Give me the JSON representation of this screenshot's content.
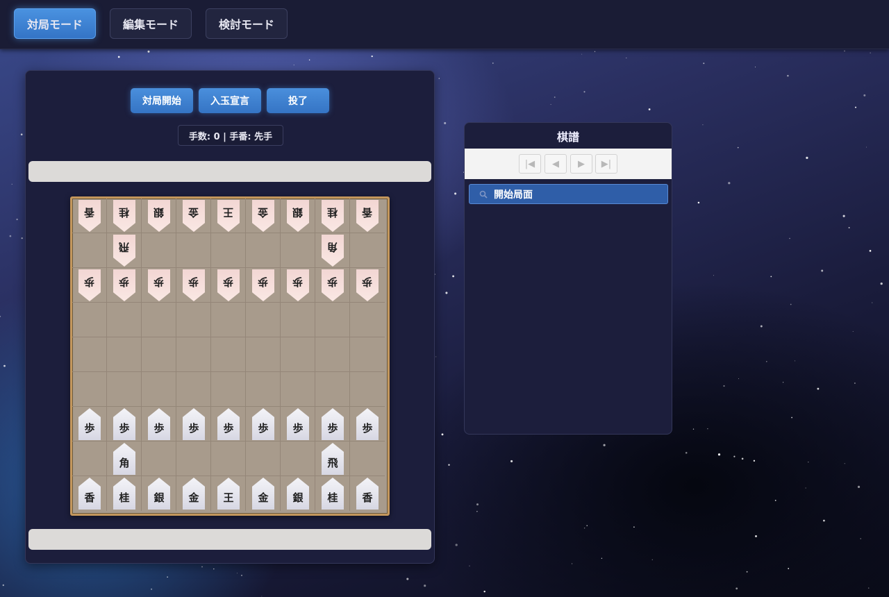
{
  "modes": {
    "tabs": [
      {
        "label": "対局モード",
        "active": true
      },
      {
        "label": "編集モード",
        "active": false
      },
      {
        "label": "検討モード",
        "active": false
      }
    ]
  },
  "controls": {
    "start_label": "対局開始",
    "declare_label": "入玉宣言",
    "resign_label": "投了"
  },
  "status": {
    "text": "手数: 0 | 手番: 先手"
  },
  "board": {
    "rows": [
      [
        "香",
        "桂",
        "銀",
        "金",
        "王",
        "金",
        "銀",
        "桂",
        "香"
      ],
      [
        "",
        "飛",
        "",
        "",
        "",
        "",
        "",
        "角",
        ""
      ],
      [
        "歩",
        "歩",
        "歩",
        "歩",
        "歩",
        "歩",
        "歩",
        "歩",
        "歩"
      ],
      [
        "",
        "",
        "",
        "",
        "",
        "",
        "",
        "",
        ""
      ],
      [
        "",
        "",
        "",
        "",
        "",
        "",
        "",
        "",
        ""
      ],
      [
        "",
        "",
        "",
        "",
        "",
        "",
        "",
        "",
        ""
      ],
      [
        "歩",
        "歩",
        "歩",
        "歩",
        "歩",
        "歩",
        "歩",
        "歩",
        "歩"
      ],
      [
        "",
        "角",
        "",
        "",
        "",
        "",
        "",
        "飛",
        ""
      ],
      [
        "香",
        "桂",
        "銀",
        "金",
        "王",
        "金",
        "銀",
        "桂",
        "香"
      ]
    ],
    "owners": [
      [
        "g",
        "g",
        "g",
        "g",
        "g",
        "g",
        "g",
        "g",
        "g"
      ],
      [
        "",
        "g",
        "",
        "",
        "",
        "",
        "",
        "g",
        ""
      ],
      [
        "g",
        "g",
        "g",
        "g",
        "g",
        "g",
        "g",
        "g",
        "g"
      ],
      [
        "",
        "",
        "",
        "",
        "",
        "",
        "",
        "",
        ""
      ],
      [
        "",
        "",
        "",
        "",
        "",
        "",
        "",
        "",
        ""
      ],
      [
        "",
        "",
        "",
        "",
        "",
        "",
        "",
        "",
        ""
      ],
      [
        "s",
        "s",
        "s",
        "s",
        "s",
        "s",
        "s",
        "s",
        "s"
      ],
      [
        "",
        "s",
        "",
        "",
        "",
        "",
        "",
        "s",
        ""
      ],
      [
        "s",
        "s",
        "s",
        "s",
        "s",
        "s",
        "s",
        "s",
        "s"
      ]
    ]
  },
  "kifu": {
    "title": "棋譜",
    "nav": {
      "first": "|◀",
      "prev": "◀",
      "next": "▶",
      "last": "▶|"
    },
    "items": [
      {
        "label": "開始局面",
        "icon": "search-icon",
        "selected": true
      }
    ]
  },
  "colors": {
    "accent": "#4a8fdc",
    "panel": "#1c1e3c",
    "board": "#a89b8c"
  }
}
